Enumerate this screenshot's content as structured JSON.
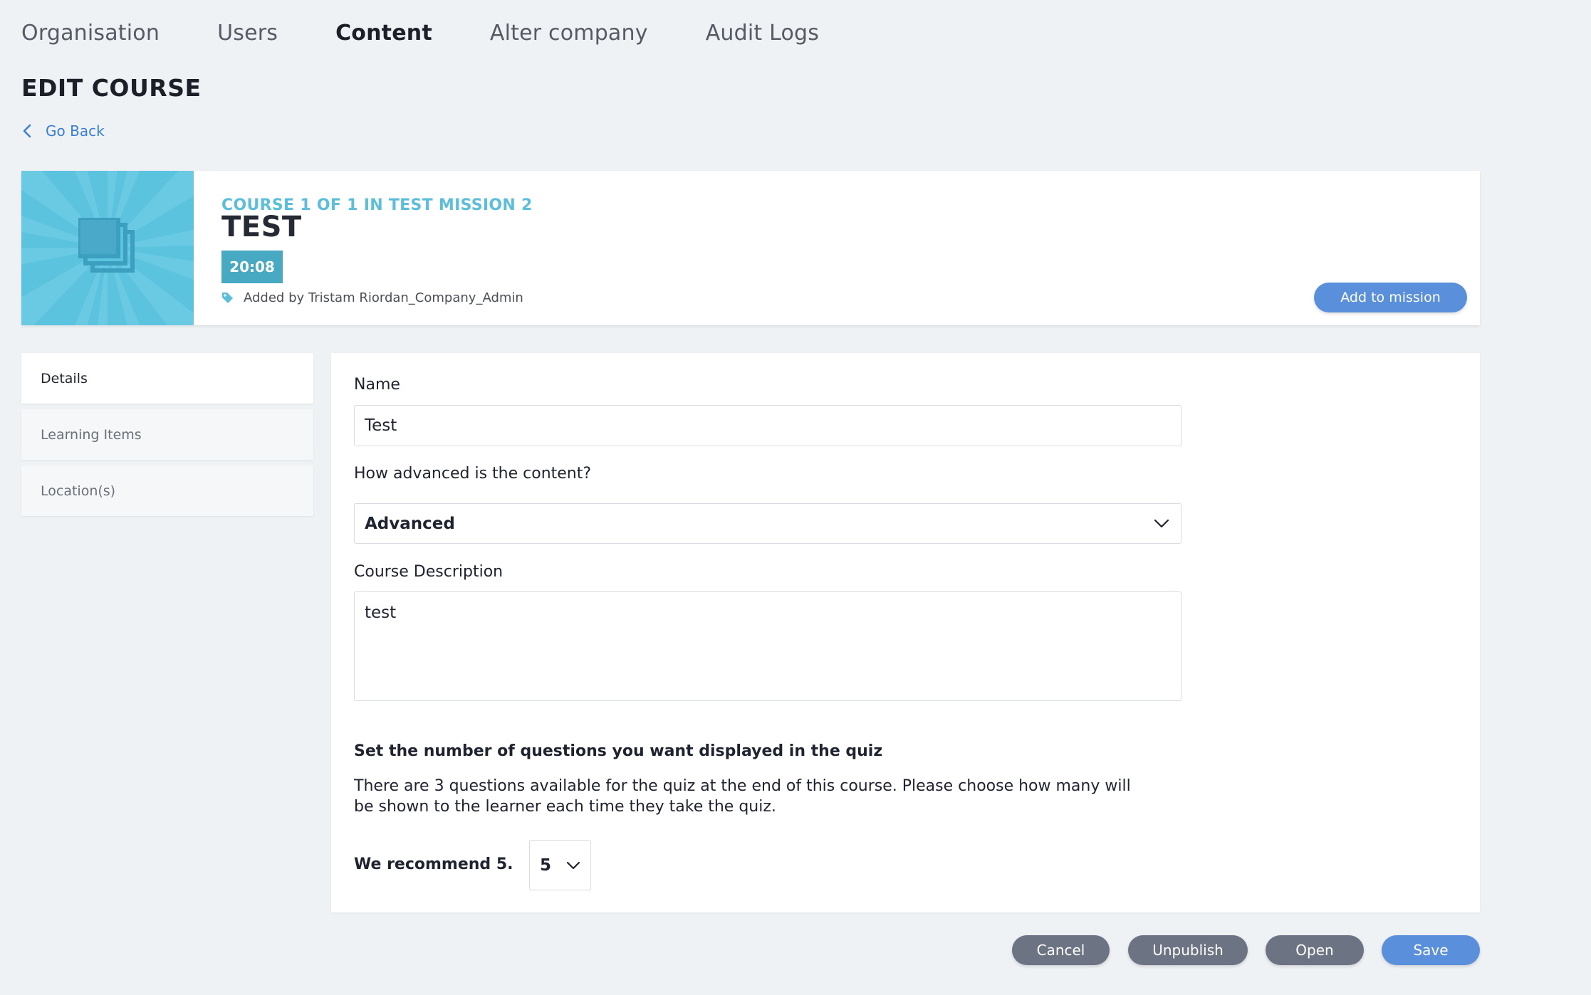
{
  "nav": {
    "tabs": [
      {
        "label": "Organisation",
        "active": false
      },
      {
        "label": "Users",
        "active": false
      },
      {
        "label": "Content",
        "active": true
      },
      {
        "label": "Alter company",
        "active": false
      },
      {
        "label": "Audit Logs",
        "active": false
      }
    ]
  },
  "page": {
    "title": "EDIT COURSE",
    "go_back": "Go Back"
  },
  "course": {
    "subtitle": "COURSE 1 OF 1 IN TEST MISSION 2",
    "title": "TEST",
    "duration": "20:08",
    "added_by": "Added by Tristam Riordan_Company_Admin",
    "add_to_mission": "Add to mission",
    "thumbnail_icon": "stacked-squares-icon"
  },
  "side_tabs": [
    {
      "label": "Details",
      "active": true
    },
    {
      "label": "Learning Items",
      "active": false
    },
    {
      "label": "Location(s)",
      "active": false
    }
  ],
  "form": {
    "name_label": "Name",
    "name_value": "Test",
    "advanced_label": "How advanced is the content?",
    "advanced_value": "Advanced",
    "description_label": "Course Description",
    "description_value": "test",
    "quiz_title": "Set the number of questions you want displayed in the quiz",
    "quiz_desc": "There are 3 questions available for the quiz at the end of this course. Please choose how many will be shown to the learner each time they take the quiz.",
    "recommend": "We recommend 5.",
    "quiz_count": "5"
  },
  "actions": {
    "cancel": "Cancel",
    "unpublish": "Unpublish",
    "open": "Open",
    "save": "Save"
  },
  "colors": {
    "accent": "#5a8fdc",
    "link": "#3b7fd0",
    "course_subtitle": "#5bbfdb",
    "duration_badge": "#47aac2",
    "thumbnail_bg": "#5cc3df",
    "secondary_button": "#6c7382",
    "background": "#eff2f5"
  }
}
